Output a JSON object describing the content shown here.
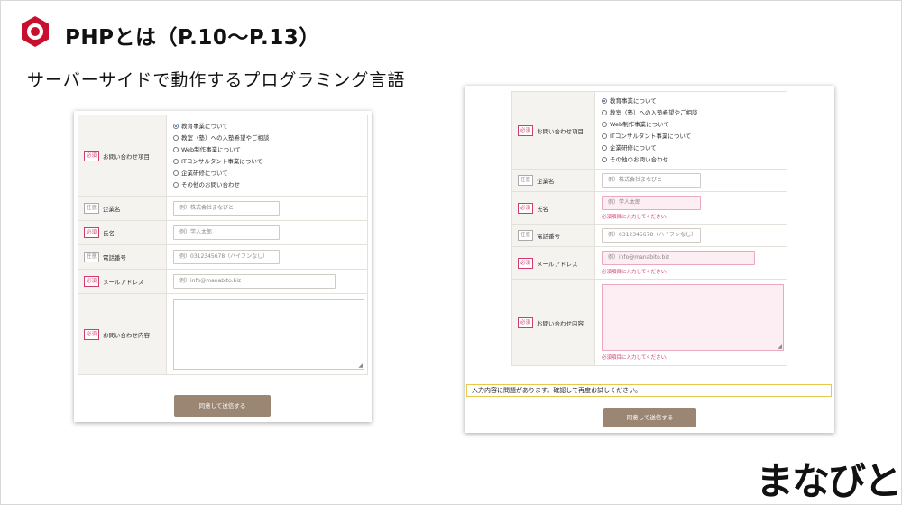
{
  "slide": {
    "title": "PHPとは（P.10〜P.13）",
    "subtitle": "サーバーサイドで動作するプログラミング言語",
    "logo": "まなびと",
    "accent_color": "#c8102e"
  },
  "form": {
    "required_badge": "必須",
    "optional_badge": "任意",
    "inquiry_label": "お問い合わせ項目",
    "options": [
      "教育事業について",
      "教室（塾）への入塾希望やご相談",
      "Web制作事業について",
      "ITコンサルタント事業について",
      "企業研修について",
      "その他のお問い合わせ"
    ],
    "selected_option": "教育事業について",
    "company_label": "企業名",
    "company_placeholder": "例）株式会社まなびと",
    "name_label": "氏名",
    "name_placeholder": "例）学人太郎",
    "phone_label": "電話番号",
    "phone_placeholder": "例）0312345678（ハイフンなし）",
    "email_label": "メールアドレス",
    "email_placeholder": "例）info@manabito.biz",
    "message_label": "お問い合わせ内容",
    "submit_label": "同意して送信する",
    "error_required": "必須項目に入力してください。",
    "error_alert": "入力内容に問題があります。確認して再度お試しください。",
    "colors": {
      "required": "#d23b6e",
      "submit": "#9a8672",
      "label_bg": "#f5f3ef",
      "error_field_bg": "#fdeef3",
      "alert_border": "#e8c84a"
    }
  }
}
